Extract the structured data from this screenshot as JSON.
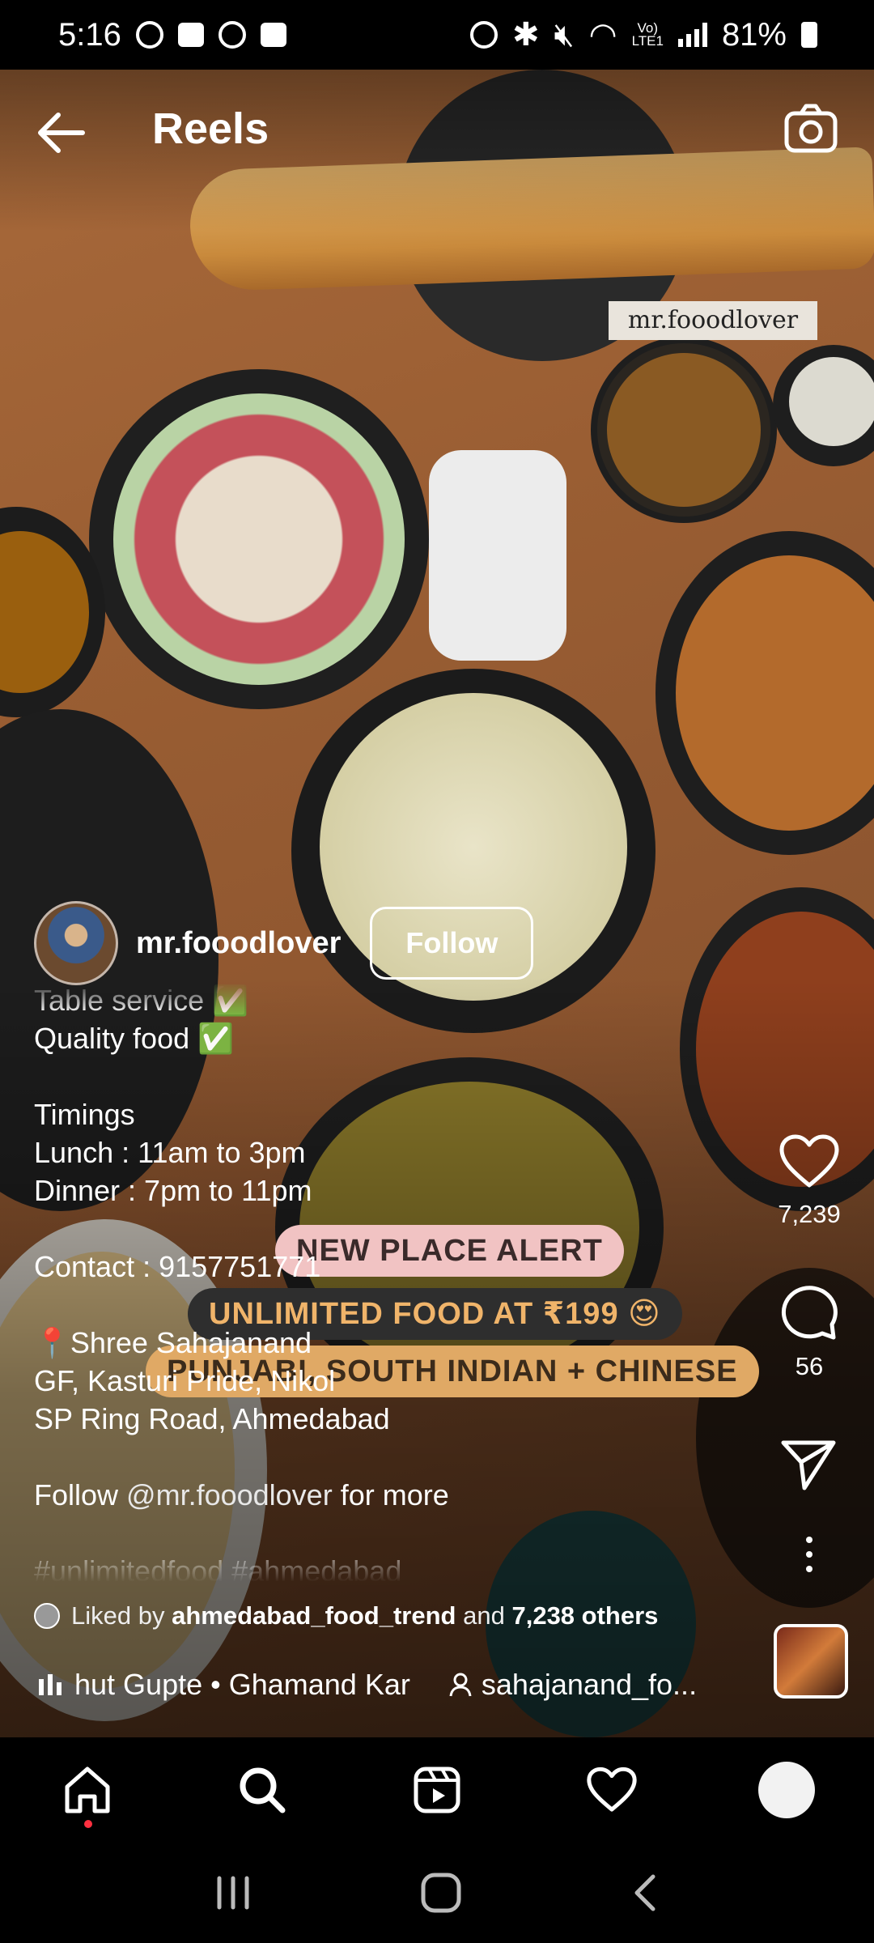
{
  "status_bar": {
    "time": "5:16",
    "battery": "81%",
    "volte": "Vo)\nLTE1"
  },
  "header": {
    "title": "Reels"
  },
  "video": {
    "watermark": "mr.fooodlover",
    "overlay_text": [
      "NEW PLACE ALERT",
      "UNLIMITED FOOD AT ₹199 😍",
      "PUNJABI, SOUTH INDIAN + CHINESE"
    ]
  },
  "author": {
    "username": "mr.fooodlover",
    "follow_label": "Follow"
  },
  "caption": {
    "lines_before_mention": "Table service ✅\nQuality food ✅\n\nTimings\nLunch : 11am to 3pm\nDinner : 7pm to 11pm\n\nContact : 9157751771\n\n📍Shree Sahajanand\nGF, Kasturi Pride, Nikol\nSP Ring Road, Ahmedabad\n\nFollow ",
    "mention": "@mr.fooodlover",
    "after_mention": " for more\n\n#unlimitedfood #ahmedabad"
  },
  "liked": {
    "prefix": "Liked by",
    "user": "ahmedabad_food_trend",
    "middle": "and",
    "others": "7,238 others"
  },
  "audio": {
    "track": "hut Gupte • Ghamand Kar",
    "location": "sahajanand_fo..."
  },
  "actions": {
    "likes": "7,239",
    "comments": "56"
  },
  "icons": {
    "back": "arrow-left-icon",
    "camera": "camera-icon",
    "like": "heart-icon",
    "comment": "comment-icon",
    "share": "send-icon",
    "more": "more-vertical-icon",
    "home": "home-icon",
    "search": "search-icon",
    "reels": "reels-icon",
    "activity": "heart-icon",
    "profile": "profile-avatar"
  }
}
